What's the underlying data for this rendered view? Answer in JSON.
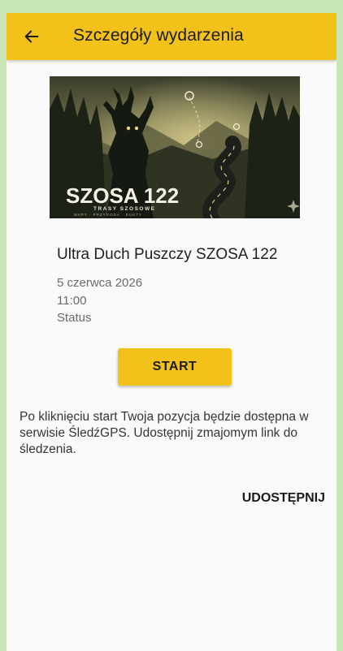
{
  "appbar": {
    "title": "Szczegóły wydarzenia",
    "back_icon": "arrow-left-icon"
  },
  "banner": {
    "logo_text": "SZOSA 122",
    "logo_subtitle": "TRASY SZOSOWE",
    "logo_tagline": "MAPY · PRZYGODA · DUKTY"
  },
  "event": {
    "title": "Ultra Duch Puszczy SZOSA 122",
    "date": "5 czerwca 2026",
    "time": "11:00",
    "status": "Status"
  },
  "actions": {
    "start_label": "START",
    "share_label": "UDOSTĘPNIJ"
  },
  "info_text": "Po kliknięciu start Twoja pozycja będzie dostępna w serwisie ŚledźGPS. Udostępnij zmajomym link do śledzenia.",
  "colors": {
    "accent": "#f2c21b",
    "background": "#fafafa",
    "outer": "#c9e6b9"
  }
}
